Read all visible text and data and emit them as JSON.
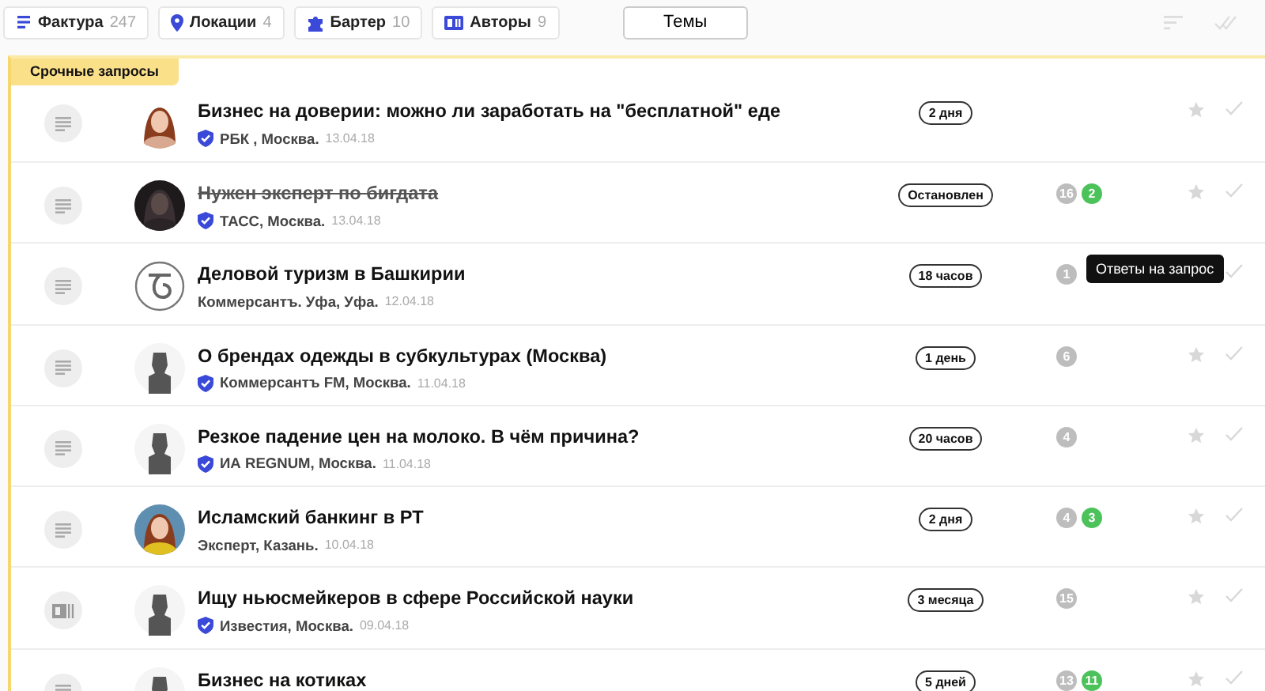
{
  "filters": [
    {
      "kind": "doc",
      "label": "Фактура",
      "count": "247"
    },
    {
      "kind": "pin",
      "label": "Локации",
      "count": "4"
    },
    {
      "kind": "puzzle",
      "label": "Бартер",
      "count": "10"
    },
    {
      "kind": "card",
      "label": "Авторы",
      "count": "9"
    }
  ],
  "topics_button": "Темы",
  "section_tag": "Срочные запросы",
  "rows": [
    {
      "kind": "doc",
      "avatar": {
        "kind": "picture"
      },
      "title": "Бизнес на доверии: можно ли заработать на \"бесплатной\" еде",
      "stopped": false,
      "verified": true,
      "source": "РБК , Москва.",
      "date": "13.04.18",
      "status": "2 дня",
      "counts": []
    },
    {
      "kind": "doc",
      "avatar": {
        "kind": "picture"
      },
      "title": "Нужен эксперт по бигдата",
      "stopped": true,
      "verified": true,
      "source": "ТАСС, Москва.",
      "date": "13.04.18",
      "status": "Остановлен",
      "counts": [
        {
          "value": "16",
          "color": "#bdbdbd"
        },
        {
          "value": "2",
          "color": "#4cc25a"
        }
      ]
    },
    {
      "kind": "doc",
      "avatar": {
        "kind": "logo"
      },
      "title": "Деловой туризм в Башкирии",
      "stopped": false,
      "verified": false,
      "source": "Коммерсантъ. Уфа, Уфа.",
      "date": "12.04.18",
      "status": "18 часов",
      "counts": [
        {
          "value": "1",
          "color": "#bdbdbd"
        }
      ],
      "tooltip": "Ответы на запрос"
    },
    {
      "kind": "doc",
      "avatar": {
        "kind": "silhouette"
      },
      "title": "О брендах одежды в субкультурах (Москва)",
      "stopped": false,
      "verified": true,
      "source": "Коммерсантъ FM, Москва.",
      "date": "11.04.18",
      "status": "1 день",
      "counts": [
        {
          "value": "6",
          "color": "#bdbdbd"
        }
      ]
    },
    {
      "kind": "doc",
      "avatar": {
        "kind": "silhouette"
      },
      "title": "Резкое падение цен на молоко. В чём причина?",
      "stopped": false,
      "verified": true,
      "source": "ИА REGNUM, Москва.",
      "date": "11.04.18",
      "status": "20 часов",
      "counts": [
        {
          "value": "4",
          "color": "#bdbdbd"
        }
      ]
    },
    {
      "kind": "doc",
      "avatar": {
        "kind": "picture"
      },
      "title": "Исламский банкинг в РТ",
      "stopped": false,
      "verified": false,
      "source": "Эксперт, Казань.",
      "date": "10.04.18",
      "status": "2 дня",
      "counts": [
        {
          "value": "4",
          "color": "#bdbdbd"
        },
        {
          "value": "3",
          "color": "#4cc25a"
        }
      ]
    },
    {
      "kind": "card",
      "avatar": {
        "kind": "silhouette"
      },
      "title": "Ищу ньюсмейкеров в сфере Российской науки",
      "stopped": false,
      "verified": true,
      "source": "Известия, Москва.",
      "date": "09.04.18",
      "status": "3 месяца",
      "counts": [
        {
          "value": "15",
          "color": "#bdbdbd"
        }
      ]
    },
    {
      "kind": "doc",
      "avatar": {
        "kind": "silhouette"
      },
      "title": "Бизнес на котиках",
      "stopped": false,
      "status": "5 дней",
      "counts": [
        {
          "value": "13",
          "color": "#bdbdbd"
        },
        {
          "value": "11",
          "color": "#4cc25a"
        }
      ]
    }
  ]
}
